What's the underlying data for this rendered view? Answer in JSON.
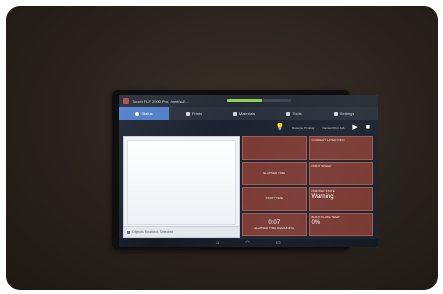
{
  "screen": {
    "app_title": "Touch FLF 2000 Pro, /mnt/sd/…",
    "progress": 0.55,
    "accent": "#4f7ec9",
    "tile_color": "#7a3a34",
    "progress_color": "#8fd14f"
  },
  "tabs": [
    {
      "label": "Status",
      "icon": "home-icon"
    },
    {
      "label": "Prints",
      "icon": "list-icon"
    },
    {
      "label": "Materials",
      "icon": "grid-icon"
    },
    {
      "label": "Tools",
      "icon": "wrench-icon"
    },
    {
      "label": "Settings",
      "icon": "gear-icon"
    }
  ],
  "tools": [
    {
      "icon": "lightbulb-icon",
      "glyph": "💡",
      "label": ""
    },
    {
      "icon": "resume-icon",
      "glyph": "",
      "label": "Resume Printing"
    },
    {
      "icon": "cancel-icon",
      "glyph": "",
      "label": "Cancel Print Job"
    },
    {
      "icon": "play-icon",
      "glyph": "▶",
      "label": ""
    },
    {
      "icon": "stop-icon",
      "glyph": "■",
      "label": ""
    }
  ],
  "preview": {
    "footer": "Objects Enabled: Selected"
  },
  "tiles": [
    {
      "label": "",
      "value": ""
    },
    {
      "label": "CURRENT LAYER INFO",
      "value": ""
    },
    {
      "label": "ELAPSED TIME",
      "value": ""
    },
    {
      "label": "PRINT SPEED",
      "value": ""
    },
    {
      "label": "START TIME",
      "value": ""
    },
    {
      "label": "PRINTER STATE",
      "value": "Warning"
    },
    {
      "label": "FINISH TIME",
      "value": ""
    },
    {
      "label": "BUILD PLATE TEMP",
      "value": "0%"
    }
  ],
  "elapsed": {
    "value": "0:07",
    "label": "ELAPSED TIME REMAINING"
  },
  "navbar": {
    "back": "⌂",
    "home": "◠",
    "recent": "▭"
  }
}
